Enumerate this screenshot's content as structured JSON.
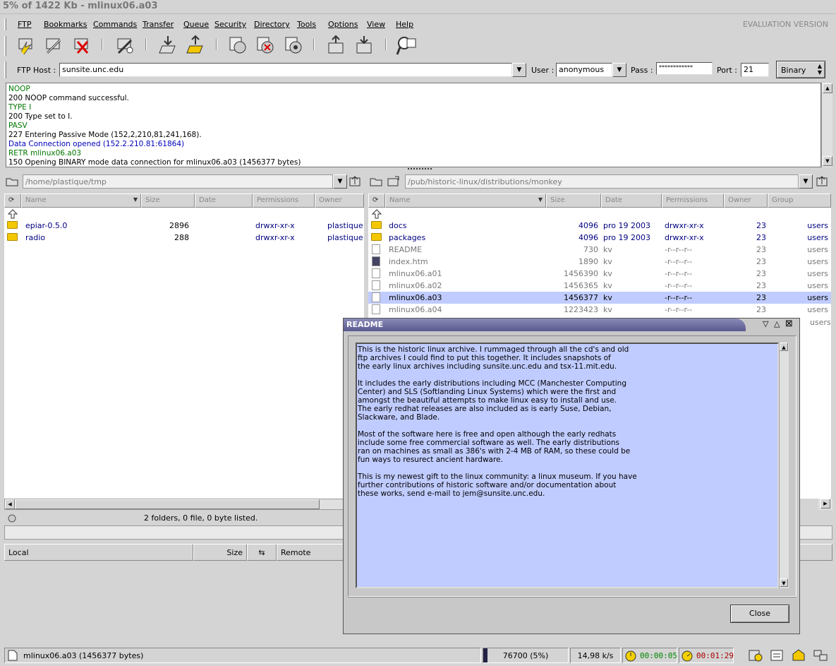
{
  "window_title": "5% of 1422 Kb  -  mlinux06.a03",
  "menu": {
    "items": [
      "FTP",
      "Bookmarks",
      "Commands",
      "Transfer",
      "Queue",
      "Security",
      "Directory",
      "Tools",
      "Options",
      "View",
      "Help"
    ],
    "eval": "EVALUATION VERSION"
  },
  "toolbar_icons": [
    "connect-icon",
    "reconnect-icon",
    "disconnect-icon",
    "quick-connect-icon",
    "download-icon",
    "upload-icon",
    "stop-icon",
    "abort-icon",
    "refresh-icon",
    "local-up-icon",
    "remote-up-icon",
    "find-icon"
  ],
  "host": {
    "ftp_host_label": "FTP Host :",
    "ftp_host": "sunsite.unc.edu",
    "user_label": "User :",
    "user": "anonymous",
    "pass_label": "Pass :",
    "pass": "************",
    "port_label": "Port :",
    "port": "21",
    "mode": "Binary"
  },
  "log": [
    {
      "t": "NOOP",
      "c": "g"
    },
    {
      "t": "200 NOOP command successful.",
      "c": ""
    },
    {
      "t": "TYPE I",
      "c": "g"
    },
    {
      "t": "200 Type set to I.",
      "c": ""
    },
    {
      "t": "PASV",
      "c": "g"
    },
    {
      "t": "227 Entering Passive Mode (152,2,210,81,241,168).",
      "c": ""
    },
    {
      "t": "Data Connection opened (152.2.210.81:61864)",
      "c": "b"
    },
    {
      "t": "RETR mlinux06.a03",
      "c": "g"
    },
    {
      "t": "150 Opening BINARY mode data connection for mlinux06.a03 (1456377 bytes)",
      "c": ""
    }
  ],
  "local": {
    "path": "/home/plastique/tmp",
    "columns": [
      "Name",
      "Size",
      "Date",
      "Permissions",
      "Owner"
    ],
    "files": [
      {
        "name": "epiar-0.5.0",
        "size": "2896",
        "perm": "drwxr-xr-x",
        "owner": "plastique"
      },
      {
        "name": "radio",
        "size": "288",
        "perm": "drwxr-xr-x",
        "owner": "plastique"
      }
    ],
    "status": "2 folders, 0 file, 0 byte listed."
  },
  "remote": {
    "path": "/pub/historic-linux/distributions/monkey",
    "columns": [
      "Name",
      "Size",
      "Date",
      "Permissions",
      "Owner",
      "Group"
    ],
    "files": [
      {
        "name": "docs",
        "size": "4096",
        "date": "pro 19 2003",
        "perm": "drwxr-xr-x",
        "owner": "23",
        "group": "users",
        "type": "folder"
      },
      {
        "name": "packages",
        "size": "4096",
        "date": "pro 19 2003",
        "perm": "drwxr-xr-x",
        "owner": "23",
        "group": "users",
        "type": "folder"
      },
      {
        "name": "README",
        "size": "730",
        "date": "kv",
        "perm": "-r--r--r--",
        "owner": "23",
        "group": "users",
        "type": "file"
      },
      {
        "name": "index.htm",
        "size": "1890",
        "date": "kv",
        "perm": "-r--r--r--",
        "owner": "23",
        "group": "users",
        "type": "html"
      },
      {
        "name": "mlinux06.a01",
        "size": "1456390",
        "date": "kv",
        "perm": "-r--r--r--",
        "owner": "23",
        "group": "users",
        "type": "file"
      },
      {
        "name": "mlinux06.a02",
        "size": "1456365",
        "date": "kv",
        "perm": "-r--r--r--",
        "owner": "23",
        "group": "users",
        "type": "file"
      },
      {
        "name": "mlinux06.a03",
        "size": "1456377",
        "date": "kv",
        "perm": "-r--r--r--",
        "owner": "23",
        "group": "users",
        "type": "file",
        "selected": true
      },
      {
        "name": "mlinux06.a04",
        "size": "1223423",
        "date": "kv",
        "perm": "-r--r--r--",
        "owner": "23",
        "group": "users",
        "type": "file"
      }
    ],
    "extra_group": "users"
  },
  "queue": {
    "local": "Local",
    "size": "Size",
    "remote": "Remote"
  },
  "bottom": {
    "file": "mlinux06.a03 (1456377 bytes)",
    "progress": "76700  (5%)",
    "progress_fraction": 0.05,
    "speed": "14,98 k/s",
    "elapsed": "00:00:05",
    "remaining": "00:01:29"
  },
  "readme": {
    "title": "README",
    "text": "This is the historic linux archive. I rummaged through all the cd's and old\nftp archives I could find to put this together. It includes snapshots of\nthe early linux archives including sunsite.unc.edu and tsx-11.mit.edu.\n\nIt includes the early distributions including MCC (Manchester Computing\nCenter) and SLS (Softlanding Linux Systems) which were the first and\namongst the beautiful attempts to make linux easy to install and use.\nThe early redhat releases are also included as is early Suse, Debian,\nSlackware, and Blade.\n\nMost of the software here is free and open although the early redhats\ninclude some free commercial software as well. The early distributions\nran on machines as small as 386's with 2-4 MB of RAM, so these could be\nfun ways to resurect ancient hardware.\n\nThis is my newest gift to the linux community: a linux museum. If you have\nfurther contributions of historic software and/or documentation about\nthese works, send e-mail to jem@sunsite.unc.edu.",
    "close": "Close"
  }
}
